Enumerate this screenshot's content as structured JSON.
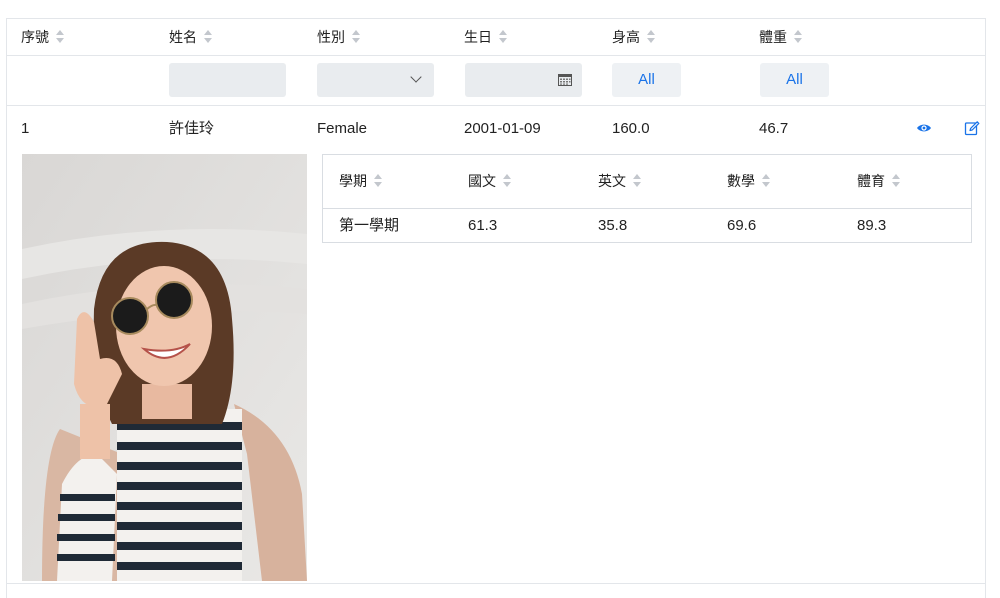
{
  "columns": [
    "序號",
    "姓名",
    "性別",
    "生日",
    "身高",
    "體重"
  ],
  "filters": {
    "height_button": "All",
    "weight_button": "All"
  },
  "row": {
    "index": "1",
    "name": "許佳玲",
    "gender": "Female",
    "birthday": "2001-01-09",
    "height": "160.0",
    "weight": "46.7"
  },
  "icons": {
    "view": "eye-icon",
    "edit": "edit-icon",
    "calendar": "calendar-icon",
    "dropdown": "chevron-down-icon",
    "sort": "sort-icon"
  },
  "subtable": {
    "columns": [
      "學期",
      "國文",
      "英文",
      "數學",
      "體育"
    ],
    "rows": [
      {
        "term": "第一學期",
        "chinese": "61.3",
        "english": "35.8",
        "math": "69.6",
        "pe": "89.3"
      }
    ]
  },
  "colors": {
    "accent": "#1a73e8",
    "border": "#e3e6ea",
    "filter_bg": "#e9ecef"
  }
}
